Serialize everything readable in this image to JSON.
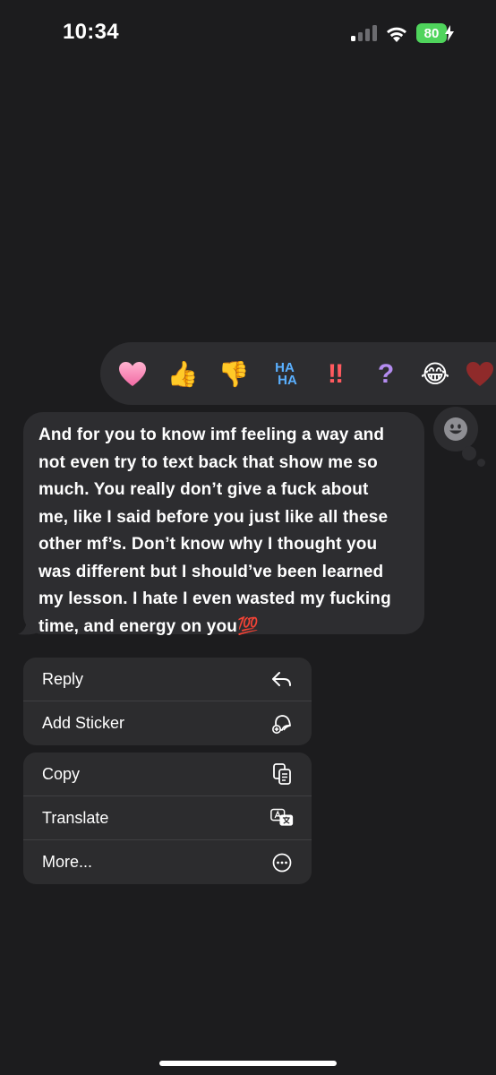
{
  "status_bar": {
    "time": "10:34",
    "battery_percent": "80",
    "battery_color": "#4fd45c",
    "signal_icon": "signal-bars-icon",
    "wifi_icon": "wifi-icon"
  },
  "reactions": [
    {
      "name": "heart",
      "glyph": ""
    },
    {
      "name": "thumbs-up",
      "glyph": "👍"
    },
    {
      "name": "thumbs-down",
      "glyph": "👎"
    },
    {
      "name": "haha",
      "glyph": ""
    },
    {
      "name": "exclamation",
      "glyph": "‼"
    },
    {
      "name": "question",
      "glyph": "?"
    },
    {
      "name": "tears-of-joy",
      "glyph": "😂"
    },
    {
      "name": "heart-partial",
      "glyph": ""
    }
  ],
  "haha_text": {
    "top": "HA",
    "bottom": "HA"
  },
  "message": {
    "text": "And for you to know imf feeling a way and not even try to text back that show me so much. You really don’t give a fuck about me, like I said before you just like all these other mf’s. Don’t know why I thought you was different but I should’ve been learned my lesson. I hate I even wasted my fucking time, and energy on you",
    "trailing_emoji": "💯",
    "bubble_color": "#2d2d30"
  },
  "menu": {
    "group1": [
      {
        "label": "Reply",
        "icon": "reply-icon"
      },
      {
        "label": "Add Sticker",
        "icon": "add-sticker-icon"
      }
    ],
    "group2": [
      {
        "label": "Copy",
        "icon": "copy-icon"
      },
      {
        "label": "Translate",
        "icon": "translate-icon"
      },
      {
        "label": "More...",
        "icon": "more-icon"
      }
    ]
  }
}
